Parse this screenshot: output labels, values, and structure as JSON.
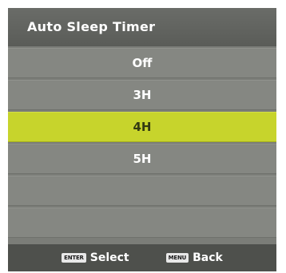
{
  "header": {
    "title": "Auto Sleep Timer"
  },
  "menu": {
    "items": [
      {
        "label": "Off",
        "selected": false
      },
      {
        "label": "3H",
        "selected": false
      },
      {
        "label": "4H",
        "selected": true
      },
      {
        "label": "5H",
        "selected": false
      },
      {
        "label": "",
        "selected": false
      },
      {
        "label": "",
        "selected": false
      }
    ]
  },
  "footer": {
    "select_key": "ENTER",
    "select_label": "Select",
    "back_key": "MENU",
    "back_label": "Back"
  },
  "colors": {
    "selection_highlight": "#c7d42c",
    "panel_background": "#7b7d78",
    "footer_background": "#4e504c"
  }
}
